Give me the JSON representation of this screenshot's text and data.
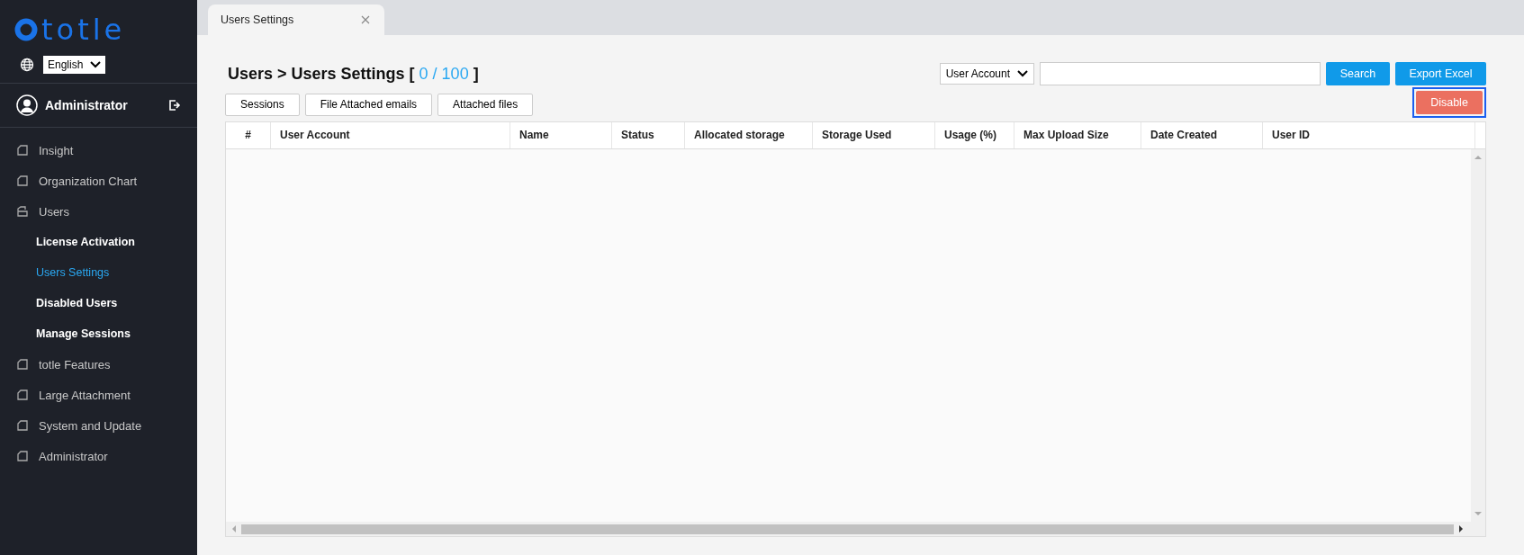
{
  "sidebar": {
    "logo": "totle",
    "language": "English",
    "user": "Administrator",
    "menu": [
      {
        "label": "Insight",
        "expanded": false
      },
      {
        "label": "Organization Chart",
        "expanded": false
      },
      {
        "label": "Users",
        "expanded": true,
        "children": [
          {
            "label": "License Activation",
            "selected": false
          },
          {
            "label": "Users Settings",
            "selected": true
          },
          {
            "label": "Disabled Users",
            "selected": false
          },
          {
            "label": "Manage Sessions",
            "selected": false
          }
        ]
      },
      {
        "label": "totle Features",
        "expanded": false
      },
      {
        "label": "Large Attachment",
        "expanded": false
      },
      {
        "label": "System and Update",
        "expanded": false
      },
      {
        "label": "Administrator",
        "expanded": false
      }
    ]
  },
  "tabs": [
    {
      "label": "Users Settings",
      "selected": true
    }
  ],
  "page": {
    "breadcrumb": "Users > Users Settings",
    "open_bracket": "[",
    "count": "0 / 100",
    "close_bracket": "]",
    "buttons": [
      "Sessions",
      "File Attached emails",
      "Attached files"
    ],
    "search": {
      "filter": "User Account"
    },
    "search_button": "Search",
    "export_button": "Export Excel",
    "disable_button": "Disable"
  },
  "table": {
    "columns": [
      "#",
      "User Account",
      "Name",
      "Status",
      "Allocated storage",
      "Storage Used",
      "Usage (%)",
      "Max Upload Size",
      "Date Created",
      "User ID"
    ]
  }
}
